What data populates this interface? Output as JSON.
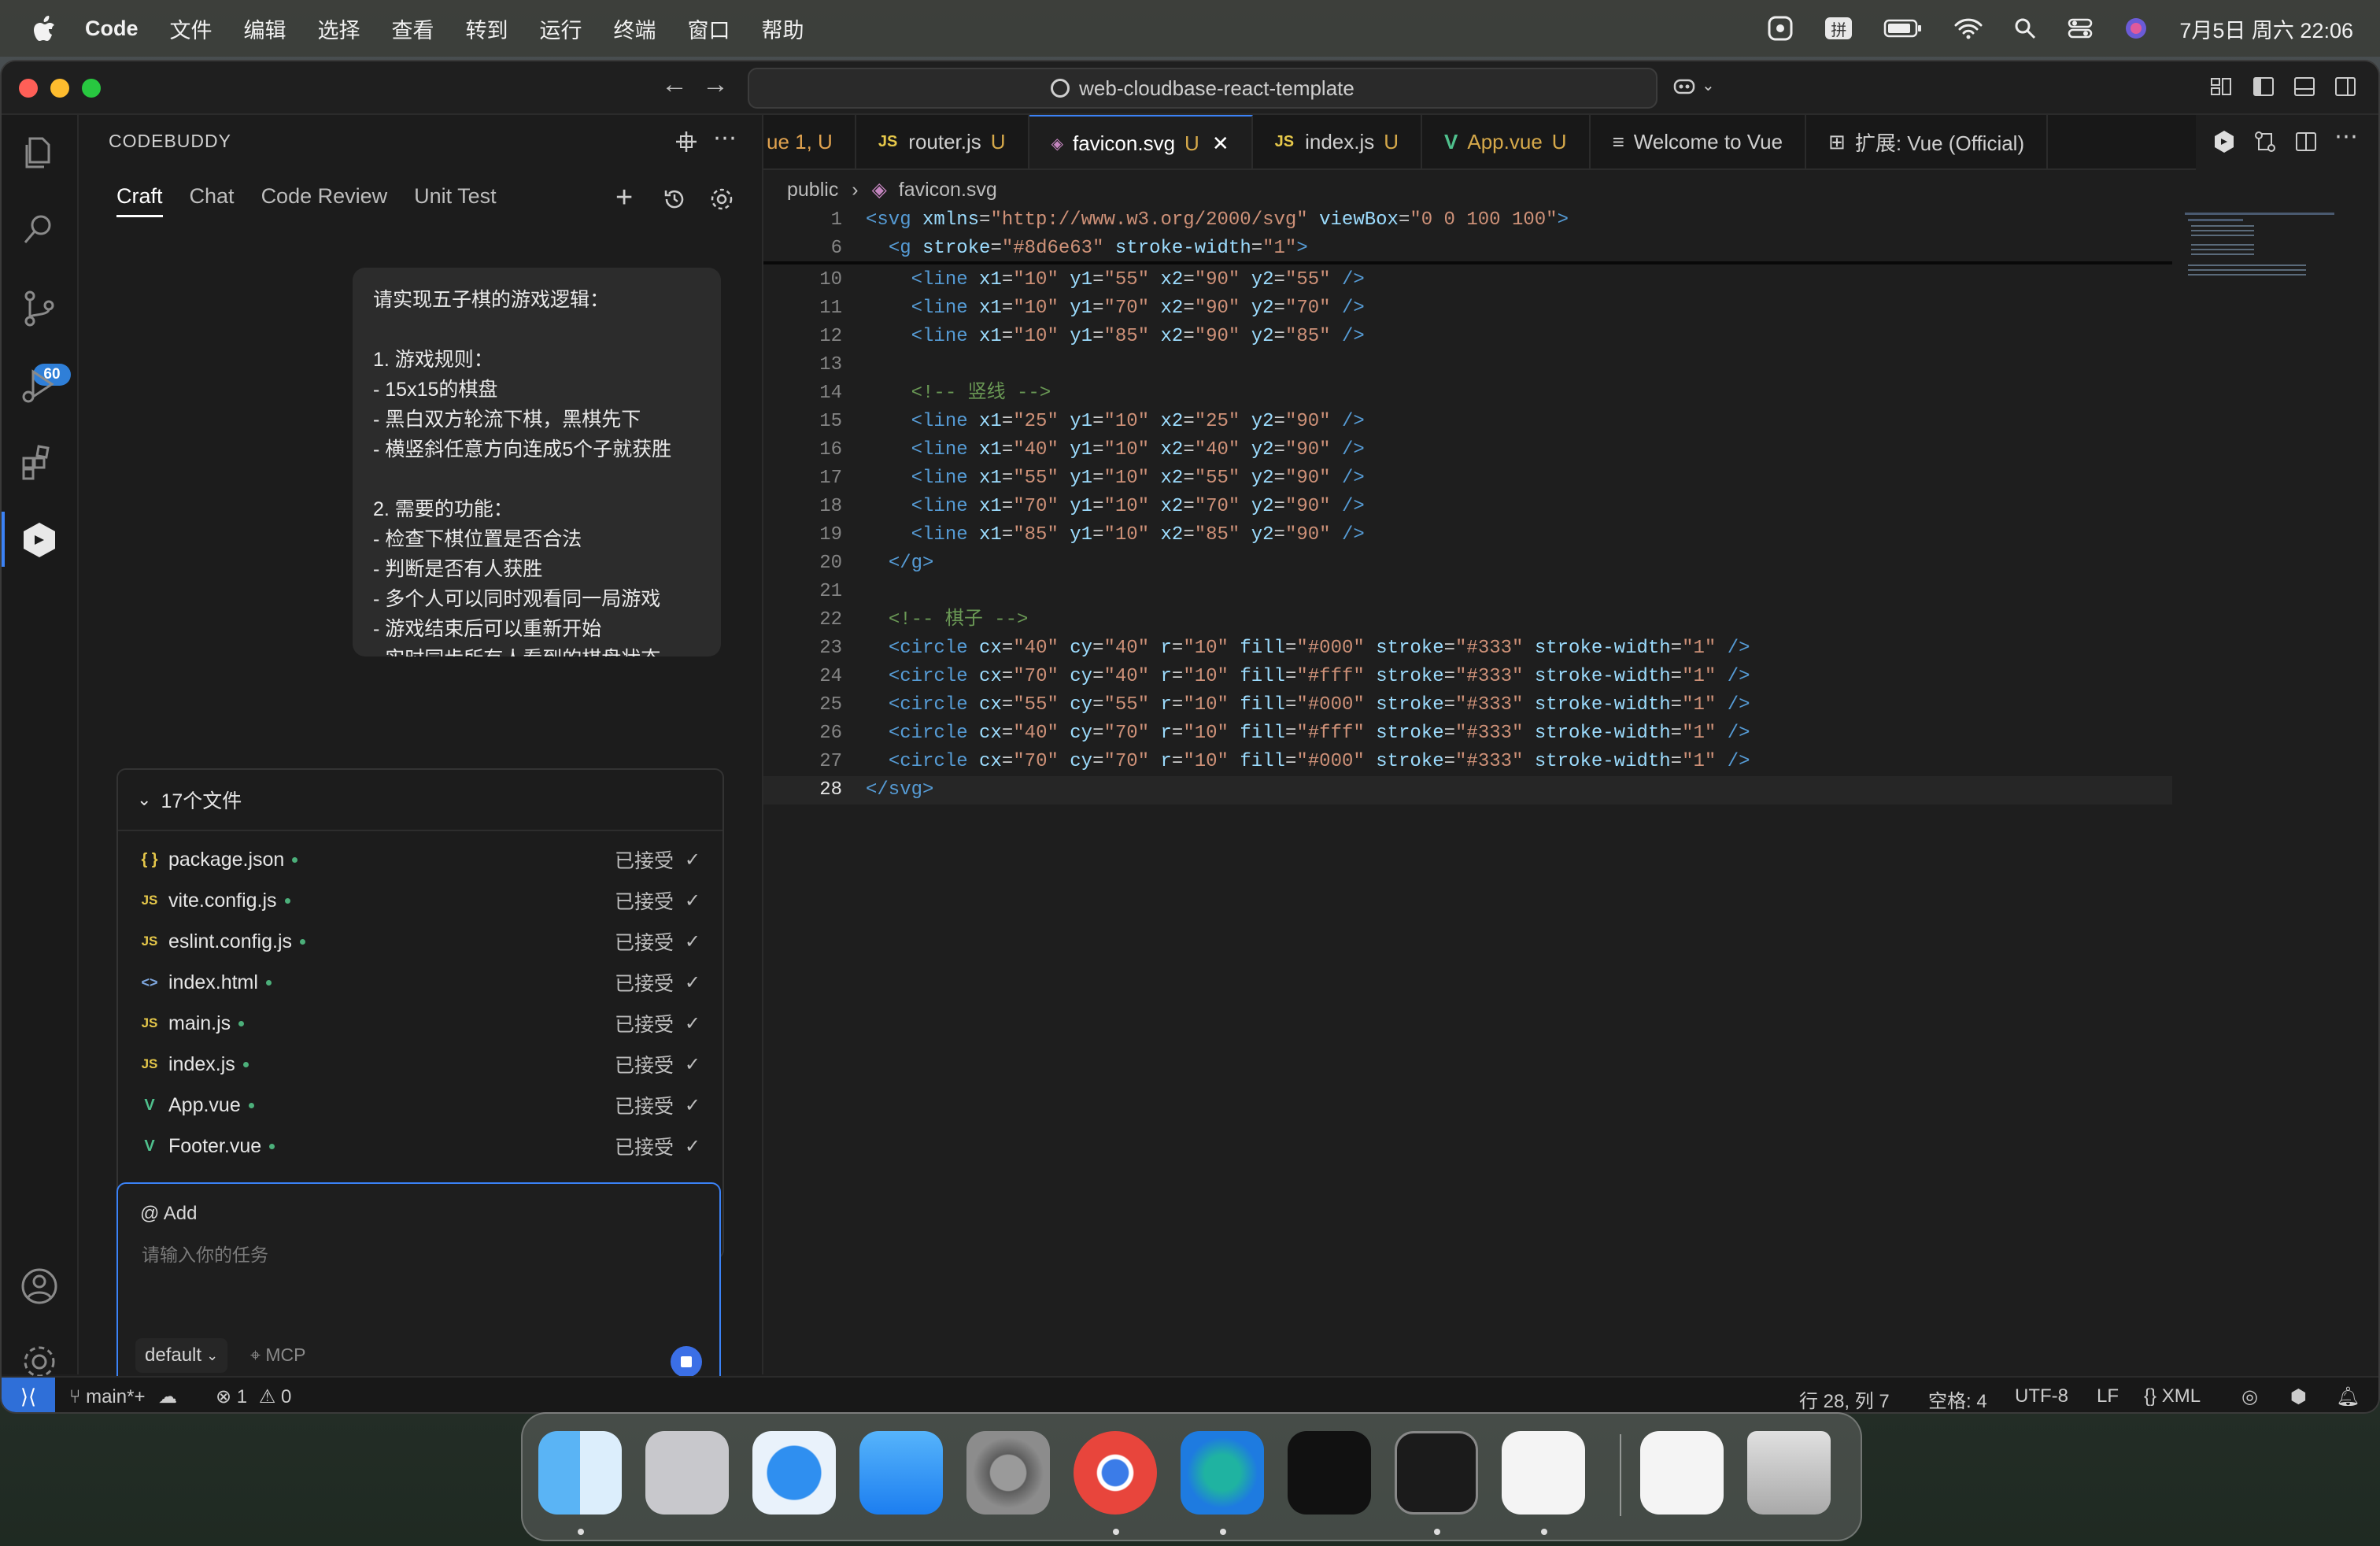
{
  "menubar": {
    "app_name": "Code",
    "menus": [
      "文件",
      "编辑",
      "选择",
      "查看",
      "转到",
      "运行",
      "终端",
      "窗口",
      "帮助"
    ],
    "input_method": "拼",
    "datetime": "7月5日 周六 22:06"
  },
  "titlebar": {
    "command_center": "web-cloudbase-react-template"
  },
  "activitybar": {
    "scm_badge": "60"
  },
  "sidepanel": {
    "title": "CODEBUDDY",
    "tabs": [
      "Craft",
      "Chat",
      "Code Review",
      "Unit Test"
    ],
    "prompt_lines": [
      "请实现五子棋的游戏逻辑：",
      "",
      "1. 游戏规则：",
      "   - 15x15的棋盘",
      "   - 黑白双方轮流下棋，黑棋先下",
      "   - 横竖斜任意方向连成5个子就获胜",
      "",
      "2. 需要的功能：",
      "   - 检查下棋位置是否合法",
      "   - 判断是否有人获胜",
      "   - 多个人可以同时观看同一局游戏",
      "   - 游戏结束后可以重新开始",
      "   - 实时同步所有人看到的棋盘状态"
    ],
    "files_header": "17个文件",
    "files": [
      {
        "icon": "{ }",
        "name": "package.json",
        "status": "已接受"
      },
      {
        "icon": "JS",
        "name": "vite.config.js",
        "status": "已接受"
      },
      {
        "icon": "JS",
        "name": "eslint.config.js",
        "status": "已接受"
      },
      {
        "icon": "<>",
        "name": "index.html",
        "status": "已接受"
      },
      {
        "icon": "JS",
        "name": "main.js",
        "status": "已接受"
      },
      {
        "icon": "JS",
        "name": "index.js",
        "status": "已接受"
      },
      {
        "icon": "V",
        "name": "App.vue",
        "status": "已接受"
      },
      {
        "icon": "V",
        "name": "Footer.vue",
        "status": "已接受"
      }
    ],
    "input": {
      "mention": "@ Add",
      "placeholder": "请输入你的任务",
      "model": "default",
      "mcp": "MCP"
    }
  },
  "editor": {
    "tabs": [
      {
        "icon": "",
        "label": "ue 1, U",
        "status": ""
      },
      {
        "icon": "JS",
        "label": "router.js",
        "status": "U"
      },
      {
        "icon": "svg",
        "label": "favicon.svg",
        "status": "U"
      },
      {
        "icon": "JS",
        "label": "index.js",
        "status": "U"
      },
      {
        "icon": "V",
        "label": "App.vue",
        "status": "U"
      },
      {
        "icon": "≡",
        "label": "Welcome to Vue",
        "status": ""
      },
      {
        "icon": "⊞",
        "label": "扩展: Vue (Official)",
        "status": ""
      }
    ],
    "breadcrumb": [
      "public",
      "favicon.svg"
    ],
    "code": [
      {
        "n": "1",
        "html": "<span class=\"tag\">&lt;svg</span> <span class=\"attr\">xmlns</span>=<span class=\"str\">\"http://www.w3.org/2000/svg\"</span> <span class=\"attr\">viewBox</span>=<span class=\"str\">\"0 0 100 100\"</span><span class=\"tag\">&gt;</span>"
      },
      {
        "n": "6",
        "html": "  <span class=\"tag\">&lt;g</span> <span class=\"attr\">stroke</span>=<span class=\"str\">\"#8d6e63\"</span> <span class=\"attr\">stroke-width</span>=<span class=\"str\">\"1\"</span><span class=\"tag\">&gt;</span>"
      },
      {
        "n": "10",
        "html": "    <span class=\"tag\">&lt;line</span> <span class=\"attr\">x1</span>=<span class=\"str\">\"10\"</span> <span class=\"attr\">y1</span>=<span class=\"str\">\"55\"</span> <span class=\"attr\">x2</span>=<span class=\"str\">\"90\"</span> <span class=\"attr\">y2</span>=<span class=\"str\">\"55\"</span> <span class=\"tag\">/&gt;</span>"
      },
      {
        "n": "11",
        "html": "    <span class=\"tag\">&lt;line</span> <span class=\"attr\">x1</span>=<span class=\"str\">\"10\"</span> <span class=\"attr\">y1</span>=<span class=\"str\">\"70\"</span> <span class=\"attr\">x2</span>=<span class=\"str\">\"90\"</span> <span class=\"attr\">y2</span>=<span class=\"str\">\"70\"</span> <span class=\"tag\">/&gt;</span>"
      },
      {
        "n": "12",
        "html": "    <span class=\"tag\">&lt;line</span> <span class=\"attr\">x1</span>=<span class=\"str\">\"10\"</span> <span class=\"attr\">y1</span>=<span class=\"str\">\"85\"</span> <span class=\"attr\">x2</span>=<span class=\"str\">\"90\"</span> <span class=\"attr\">y2</span>=<span class=\"str\">\"85\"</span> <span class=\"tag\">/&gt;</span>"
      },
      {
        "n": "13",
        "html": ""
      },
      {
        "n": "14",
        "html": "    <span class=\"cmt\">&lt;!-- 竖线 --&gt;</span>"
      },
      {
        "n": "15",
        "html": "    <span class=\"tag\">&lt;line</span> <span class=\"attr\">x1</span>=<span class=\"str\">\"25\"</span> <span class=\"attr\">y1</span>=<span class=\"str\">\"10\"</span> <span class=\"attr\">x2</span>=<span class=\"str\">\"25\"</span> <span class=\"attr\">y2</span>=<span class=\"str\">\"90\"</span> <span class=\"tag\">/&gt;</span>"
      },
      {
        "n": "16",
        "html": "    <span class=\"tag\">&lt;line</span> <span class=\"attr\">x1</span>=<span class=\"str\">\"40\"</span> <span class=\"attr\">y1</span>=<span class=\"str\">\"10\"</span> <span class=\"attr\">x2</span>=<span class=\"str\">\"40\"</span> <span class=\"attr\">y2</span>=<span class=\"str\">\"90\"</span> <span class=\"tag\">/&gt;</span>"
      },
      {
        "n": "17",
        "html": "    <span class=\"tag\">&lt;line</span> <span class=\"attr\">x1</span>=<span class=\"str\">\"55\"</span> <span class=\"attr\">y1</span>=<span class=\"str\">\"10\"</span> <span class=\"attr\">x2</span>=<span class=\"str\">\"55\"</span> <span class=\"attr\">y2</span>=<span class=\"str\">\"90\"</span> <span class=\"tag\">/&gt;</span>"
      },
      {
        "n": "18",
        "html": "    <span class=\"tag\">&lt;line</span> <span class=\"attr\">x1</span>=<span class=\"str\">\"70\"</span> <span class=\"attr\">y1</span>=<span class=\"str\">\"10\"</span> <span class=\"attr\">x2</span>=<span class=\"str\">\"70\"</span> <span class=\"attr\">y2</span>=<span class=\"str\">\"90\"</span> <span class=\"tag\">/&gt;</span>"
      },
      {
        "n": "19",
        "html": "    <span class=\"tag\">&lt;line</span> <span class=\"attr\">x1</span>=<span class=\"str\">\"85\"</span> <span class=\"attr\">y1</span>=<span class=\"str\">\"10\"</span> <span class=\"attr\">x2</span>=<span class=\"str\">\"85\"</span> <span class=\"attr\">y2</span>=<span class=\"str\">\"90\"</span> <span class=\"tag\">/&gt;</span>"
      },
      {
        "n": "20",
        "html": "  <span class=\"tag\">&lt;/g&gt;</span>"
      },
      {
        "n": "21",
        "html": ""
      },
      {
        "n": "22",
        "html": "  <span class=\"cmt\">&lt;!-- 棋子 --&gt;</span>"
      },
      {
        "n": "23",
        "html": "  <span class=\"tag\">&lt;circle</span> <span class=\"attr\">cx</span>=<span class=\"str\">\"40\"</span> <span class=\"attr\">cy</span>=<span class=\"str\">\"40\"</span> <span class=\"attr\">r</span>=<span class=\"str\">\"10\"</span> <span class=\"attr\">fill</span>=<span class=\"str\">\"#000\"</span> <span class=\"attr\">stroke</span>=<span class=\"str\">\"#333\"</span> <span class=\"attr\">stroke-width</span>=<span class=\"str\">\"1\"</span> <span class=\"tag\">/&gt;</span>"
      },
      {
        "n": "24",
        "html": "  <span class=\"tag\">&lt;circle</span> <span class=\"attr\">cx</span>=<span class=\"str\">\"70\"</span> <span class=\"attr\">cy</span>=<span class=\"str\">\"40\"</span> <span class=\"attr\">r</span>=<span class=\"str\">\"10\"</span> <span class=\"attr\">fill</span>=<span class=\"str\">\"#fff\"</span> <span class=\"attr\">stroke</span>=<span class=\"str\">\"#333\"</span> <span class=\"attr\">stroke-width</span>=<span class=\"str\">\"1\"</span> <span class=\"tag\">/&gt;</span>"
      },
      {
        "n": "25",
        "html": "  <span class=\"tag\">&lt;circle</span> <span class=\"attr\">cx</span>=<span class=\"str\">\"55\"</span> <span class=\"attr\">cy</span>=<span class=\"str\">\"55\"</span> <span class=\"attr\">r</span>=<span class=\"str\">\"10\"</span> <span class=\"attr\">fill</span>=<span class=\"str\">\"#000\"</span> <span class=\"attr\">stroke</span>=<span class=\"str\">\"#333\"</span> <span class=\"attr\">stroke-width</span>=<span class=\"str\">\"1\"</span> <span class=\"tag\">/&gt;</span>"
      },
      {
        "n": "26",
        "html": "  <span class=\"tag\">&lt;circle</span> <span class=\"attr\">cx</span>=<span class=\"str\">\"40\"</span> <span class=\"attr\">cy</span>=<span class=\"str\">\"70\"</span> <span class=\"attr\">r</span>=<span class=\"str\">\"10\"</span> <span class=\"attr\">fill</span>=<span class=\"str\">\"#fff\"</span> <span class=\"attr\">stroke</span>=<span class=\"str\">\"#333\"</span> <span class=\"attr\">stroke-width</span>=<span class=\"str\">\"1\"</span> <span class=\"tag\">/&gt;</span>"
      },
      {
        "n": "27",
        "html": "  <span class=\"tag\">&lt;circle</span> <span class=\"attr\">cx</span>=<span class=\"str\">\"70\"</span> <span class=\"attr\">cy</span>=<span class=\"str\">\"70\"</span> <span class=\"attr\">r</span>=<span class=\"str\">\"10\"</span> <span class=\"attr\">fill</span>=<span class=\"str\">\"#000\"</span> <span class=\"attr\">stroke</span>=<span class=\"str\">\"#333\"</span> <span class=\"attr\">stroke-width</span>=<span class=\"str\">\"1\"</span> <span class=\"tag\">/&gt;</span>"
      },
      {
        "n": "28",
        "html": "<span class=\"tag\">&lt;/svg&gt;</span>"
      }
    ]
  },
  "statusbar": {
    "branch": "main*+",
    "errors": "1",
    "warnings": "0",
    "position": "行 28, 列 7",
    "indent": "空格: 4",
    "encoding": "UTF-8",
    "eol": "LF",
    "language": "XML"
  },
  "dock": {
    "apps": [
      "finder-icon",
      "launchpad-icon",
      "safari-icon",
      "mail-icon",
      "system-settings-icon",
      "chrome-icon",
      "edge-icon",
      "cursor-icon",
      "terminal-icon",
      "vscode-icon",
      "vscode-insiders-icon",
      "trash-icon"
    ]
  },
  "colors": {
    "accent": "#3b82f6",
    "tag": "#569cd6",
    "attribute": "#9cdcfe",
    "string": "#ce9178",
    "comment": "#6a9955"
  }
}
